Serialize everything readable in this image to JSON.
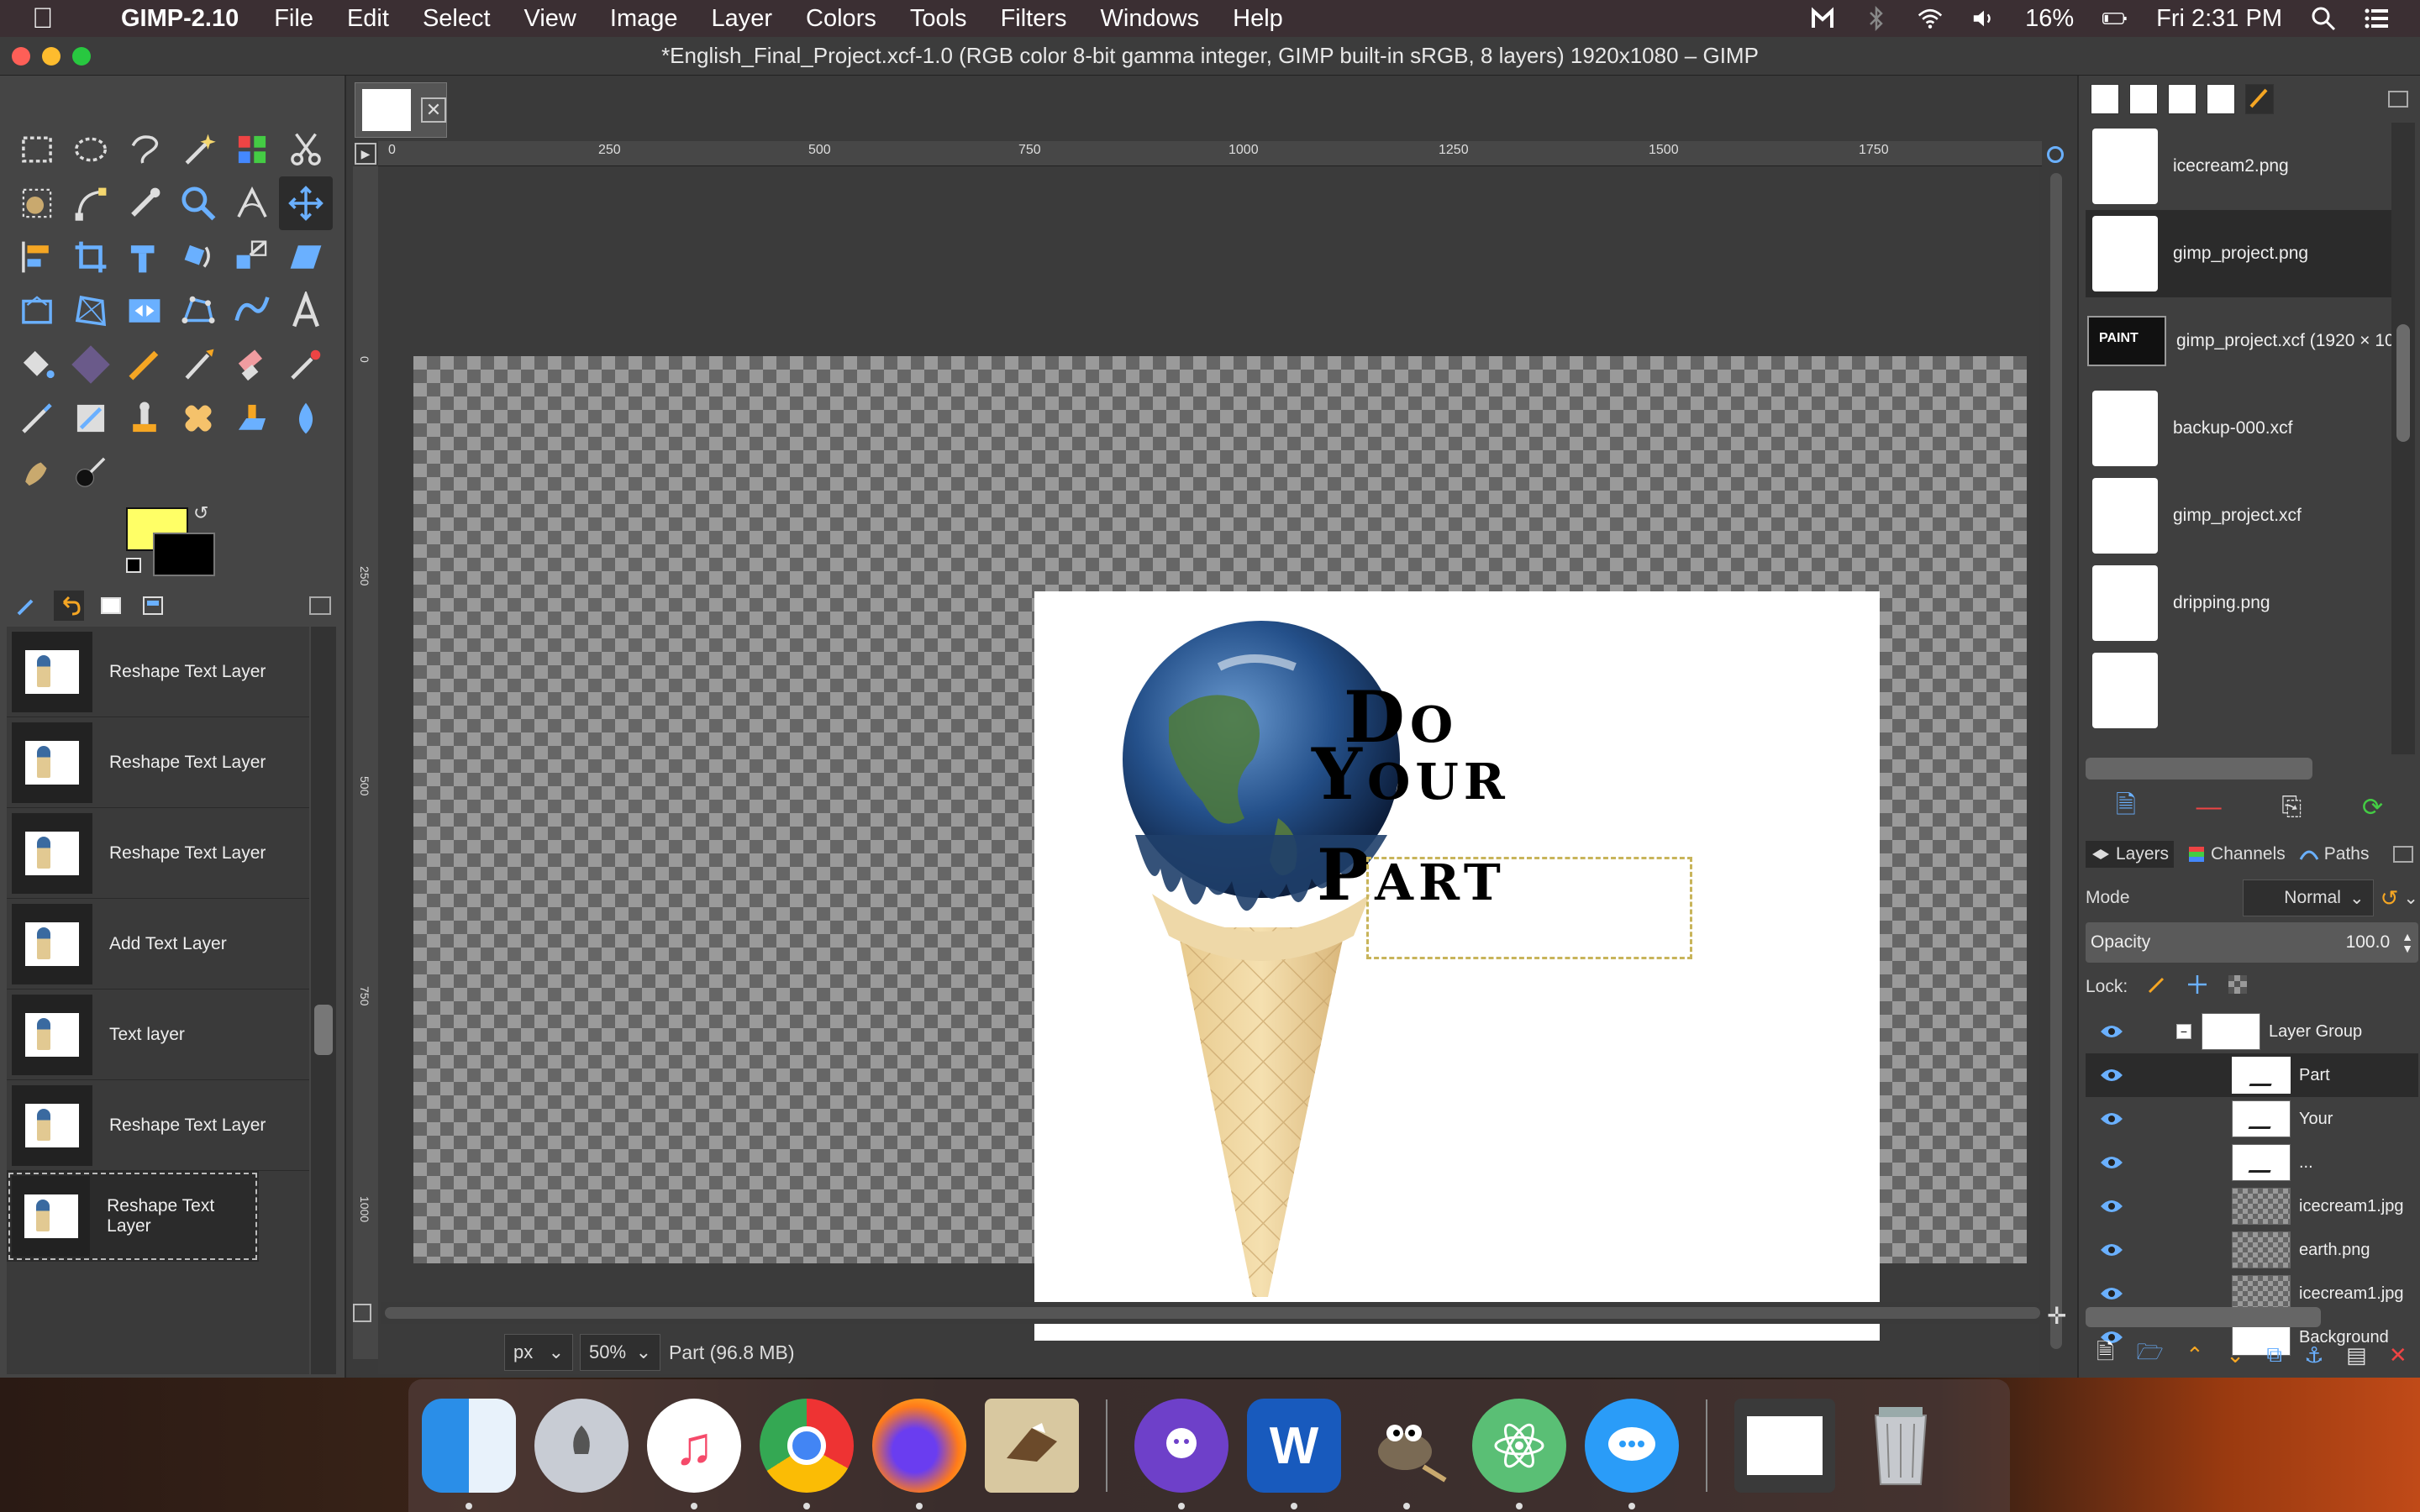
{
  "menubar": {
    "app": "GIMP-2.10",
    "items": [
      "File",
      "Edit",
      "Select",
      "View",
      "Image",
      "Layer",
      "Colors",
      "Tools",
      "Filters",
      "Windows",
      "Help"
    ],
    "battery": "16%",
    "clock": "Fri 2:31 PM"
  },
  "window": {
    "title": "*English_Final_Project.xcf-1.0 (RGB color 8-bit gamma integer, GIMP built-in sRGB, 8 layers) 1920x1080 – GIMP"
  },
  "toolbox": {
    "fg_color": "#ffff66",
    "bg_color": "#000000"
  },
  "undo_history": {
    "items": [
      "Reshape Text Layer",
      "Reshape Text Layer",
      "Reshape Text Layer",
      "Add Text Layer",
      "Text layer",
      "Reshape Text Layer",
      "Reshape Text Layer"
    ]
  },
  "ruler": {
    "labels": [
      "0",
      "250",
      "500",
      "750",
      "1000",
      "1250",
      "1500",
      "1750"
    ],
    "vlabels": [
      "0",
      "250",
      "500",
      "750",
      "1000"
    ]
  },
  "canvas": {
    "words": [
      "Do",
      "Your",
      "Part"
    ]
  },
  "statusbar": {
    "unit": "px",
    "zoom": "50%",
    "info": "Part (96.8 MB)"
  },
  "images_panel": {
    "items": [
      "icecream2.png",
      "gimp_project.png",
      "gimp_project.xcf (1920 × 10",
      "backup-000.xcf",
      "gimp_project.xcf",
      "dripping.png"
    ]
  },
  "layers_panel": {
    "tabs": [
      "Layers",
      "Channels",
      "Paths"
    ],
    "mode_label": "Mode",
    "mode_value": "Normal",
    "opacity_label": "Opacity",
    "opacity_value": "100.0",
    "lock_label": "Lock:",
    "layers": [
      "Layer Group",
      "Part",
      "Your",
      "...",
      "icecream1.jpg",
      "earth.png",
      "icecream1.jpg",
      "Background"
    ]
  }
}
